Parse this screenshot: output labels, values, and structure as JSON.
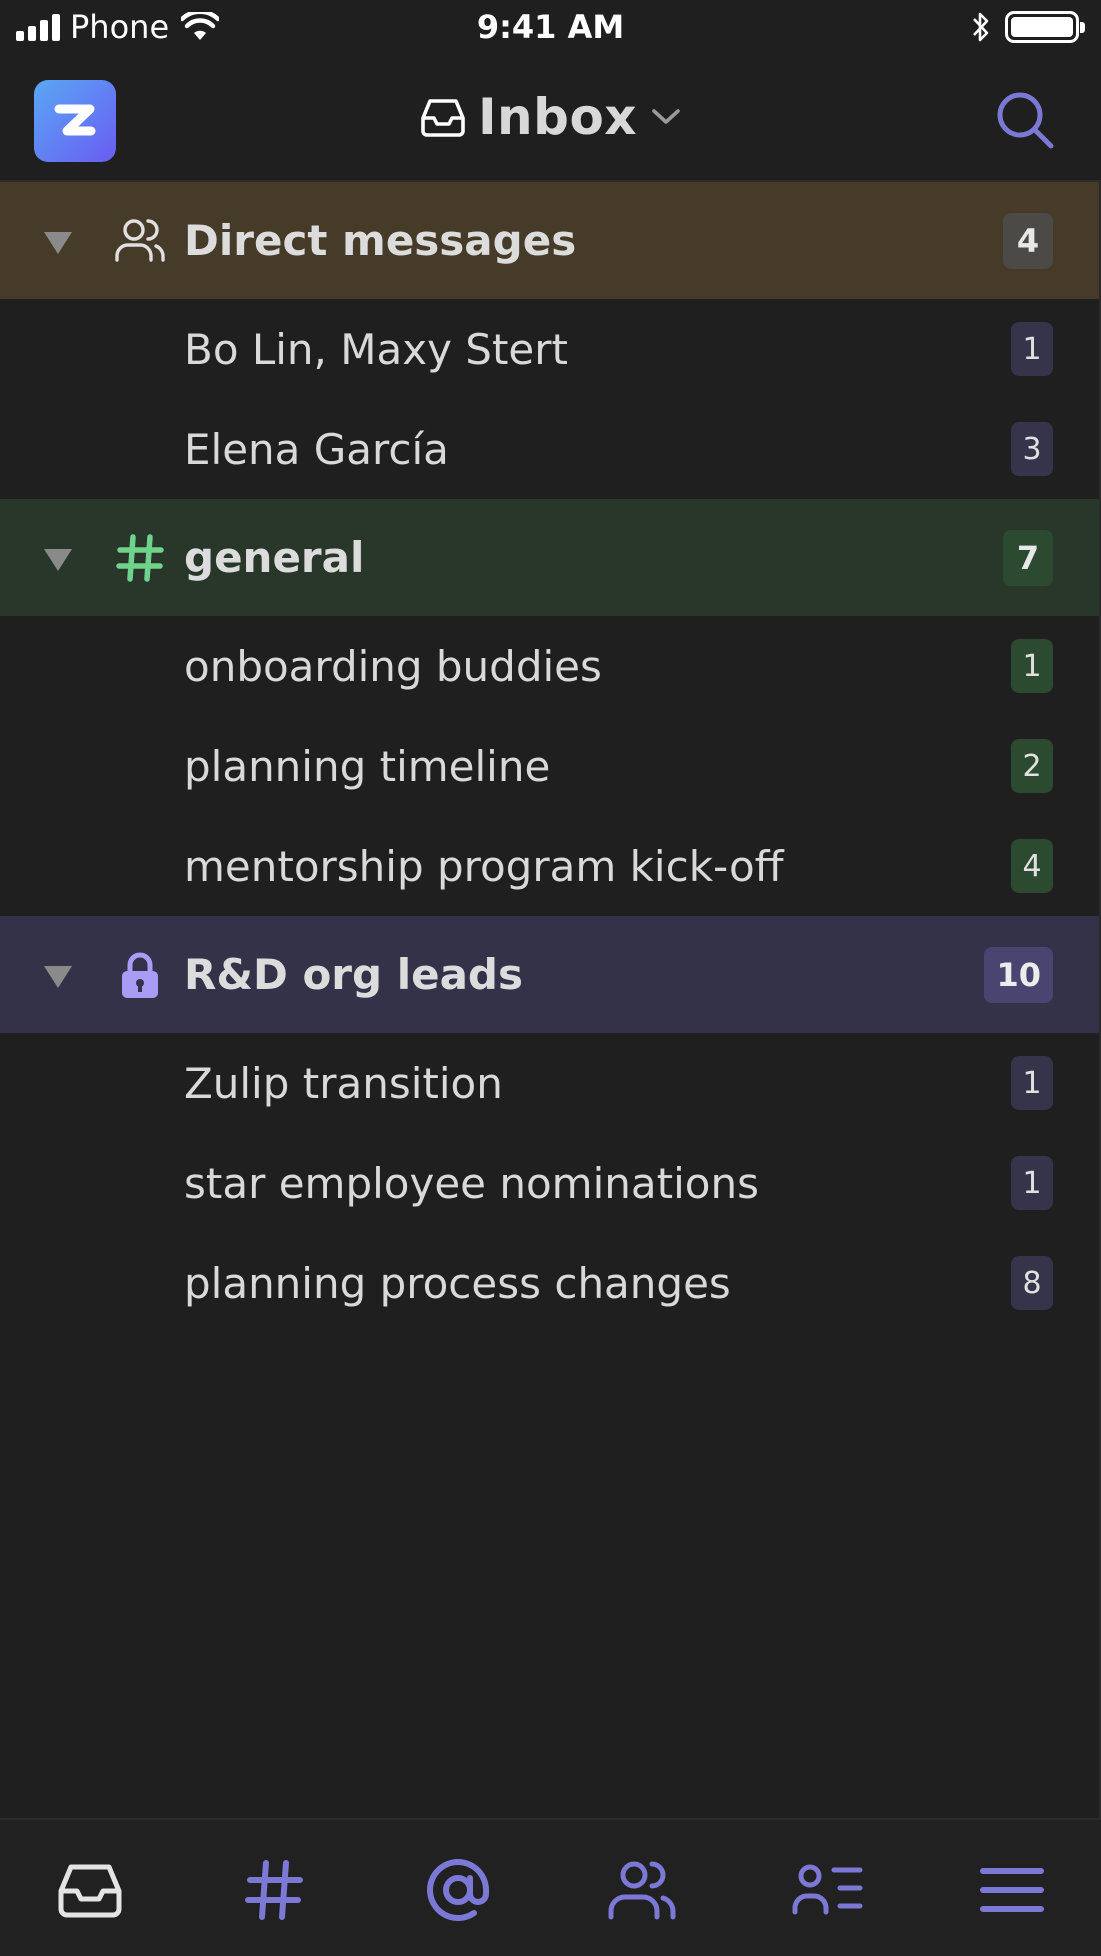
{
  "status_bar": {
    "carrier": "Phone",
    "time": "9:41 AM"
  },
  "header": {
    "title": "Inbox"
  },
  "colors": {
    "dm_header_bg": "#453b28",
    "dm_badge_bg": "#4b4a47",
    "dm_row_badge_bg": "#35344a",
    "general_header_bg": "#28372a",
    "general_accent": "#6fd38e",
    "general_badge_bg": "#2b4a30",
    "rd_header_bg": "#343248",
    "rd_accent": "#a99cf5",
    "rd_badge_bg": "#4a4570",
    "tab_icon": "#7b78d6"
  },
  "groups": [
    {
      "title": "Direct messages",
      "icon": "users-icon",
      "count": "4",
      "items": [
        {
          "label": "Bo Lin, Maxy Stert",
          "count": "1"
        },
        {
          "label": "Elena García",
          "count": "3"
        }
      ]
    },
    {
      "title": "general",
      "icon": "hash-icon",
      "count": "7",
      "items": [
        {
          "label": "onboarding buddies",
          "count": "1"
        },
        {
          "label": "planning timeline",
          "count": "2"
        },
        {
          "label": "mentorship program kick-off",
          "count": "4"
        }
      ]
    },
    {
      "title": "R&D org leads",
      "icon": "lock-icon",
      "count": "10",
      "items": [
        {
          "label": "Zulip transition",
          "count": "1"
        },
        {
          "label": "star employee nominations",
          "count": "1"
        },
        {
          "label": "planning process changes",
          "count": "8"
        }
      ]
    }
  ],
  "tabs": [
    {
      "icon": "inbox-icon"
    },
    {
      "icon": "hash-icon"
    },
    {
      "icon": "at-sign-icon"
    },
    {
      "icon": "users-icon"
    },
    {
      "icon": "user-list-icon"
    },
    {
      "icon": "menu-icon"
    }
  ]
}
